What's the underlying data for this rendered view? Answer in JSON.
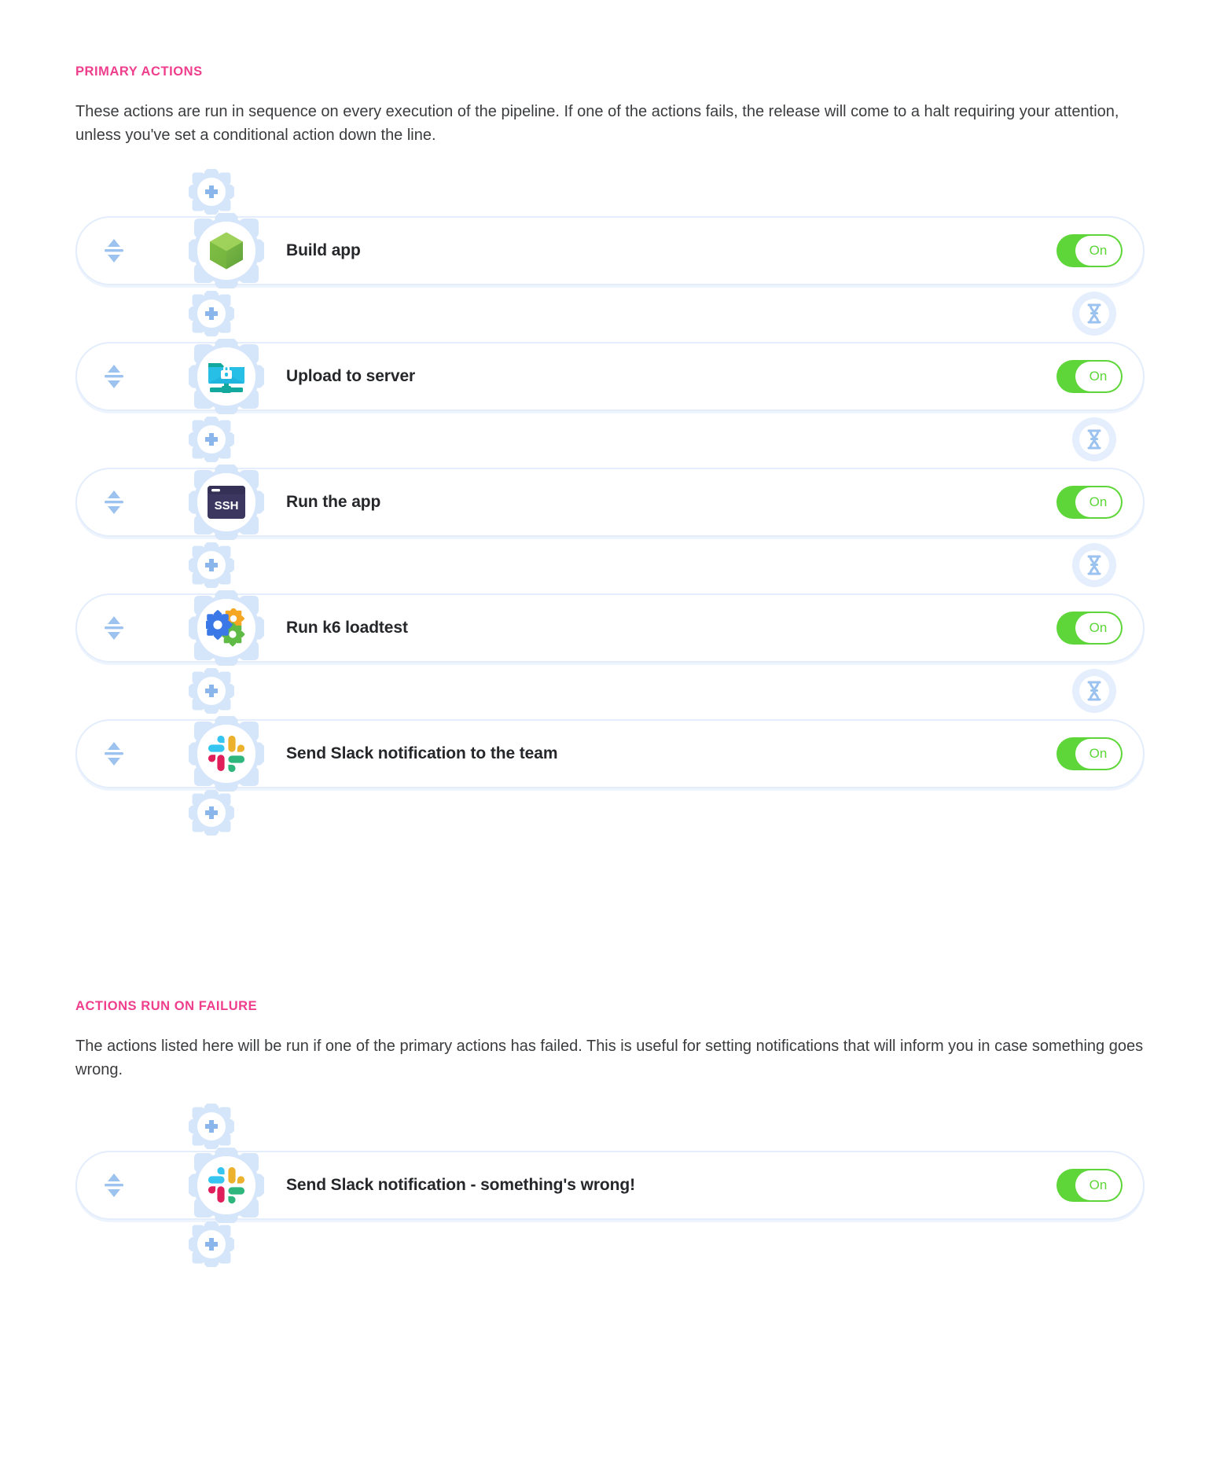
{
  "sections": [
    {
      "heading": "PRIMARY ACTIONS",
      "description": "These actions are run in sequence on every execution of the pipeline. If one of the actions fails, the release will come to a halt requiring your attention, unless you've set a conditional action down the line.",
      "actions": [
        {
          "label": "Build app",
          "icon": "nodejs-icon",
          "toggle": "On",
          "toggle_state": "on",
          "has_wait_after": true
        },
        {
          "label": "Upload to server",
          "icon": "sftp-upload-icon",
          "toggle": "On",
          "toggle_state": "on",
          "has_wait_after": true
        },
        {
          "label": "Run the app",
          "icon": "ssh-terminal-icon",
          "toggle": "On",
          "toggle_state": "on",
          "has_wait_after": true
        },
        {
          "label": "Run k6 loadtest",
          "icon": "gears-icon",
          "toggle": "On",
          "toggle_state": "on",
          "has_wait_after": true
        },
        {
          "label": "Send Slack notification to the team",
          "icon": "slack-icon",
          "toggle": "On",
          "toggle_state": "on",
          "has_wait_after": false
        }
      ]
    },
    {
      "heading": "ACTIONS RUN ON FAILURE",
      "description": "The actions listed here will be run if one of the primary actions has failed. This is useful for setting notifications that will inform you in case something goes wrong.",
      "actions": [
        {
          "label": "Send Slack notification - something's wrong!",
          "icon": "slack-icon",
          "toggle": "On",
          "toggle_state": "on",
          "has_wait_after": false
        }
      ]
    }
  ],
  "icons": {
    "add_action": "add-action-gear-icon",
    "wait": "hourglass-icon",
    "drag": "drag-reorder-icon"
  },
  "colors": {
    "accent_pink": "#ef3e8c",
    "toggle_green": "#5ed63a",
    "rail_blue": "#d6e6fa",
    "border_blue": "#e3edfb"
  }
}
